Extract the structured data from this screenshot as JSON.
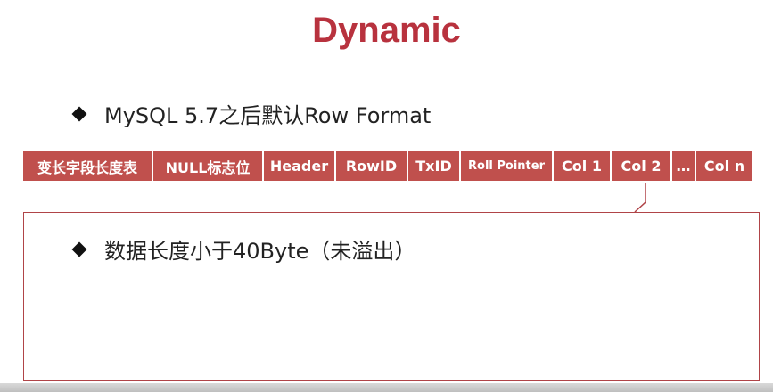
{
  "slide": {
    "title": "Dynamic",
    "bullets": [
      "MySQL 5.7之后默认Row Format",
      "数据长度小于40Byte（未溢出）"
    ],
    "row_format_fields": [
      "变长字段长度表",
      "NULL标志位",
      "Header",
      "RowID",
      "TxID",
      "Roll Pointer",
      "Col 1",
      "Col 2",
      "…",
      "Col n"
    ],
    "colors": {
      "title": "#b8323e",
      "field_fill": "#c0504d",
      "field_text": "#ffffff",
      "box_border": "#b04448"
    }
  }
}
